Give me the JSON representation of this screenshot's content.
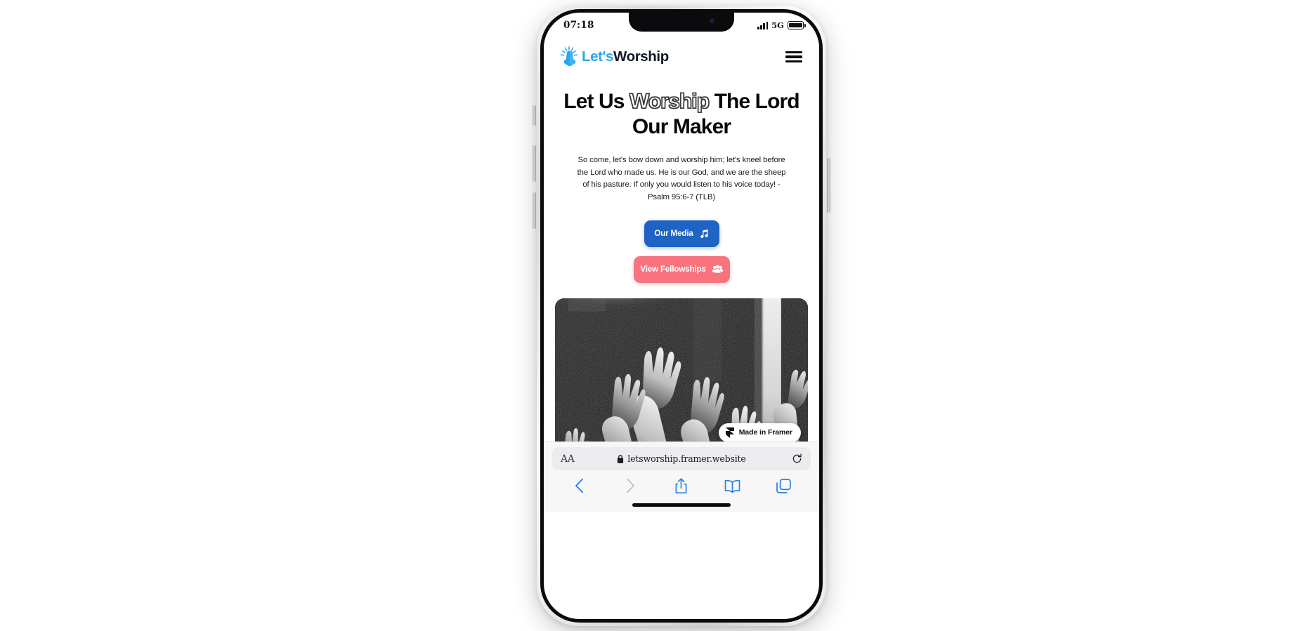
{
  "device": {
    "status_bar": {
      "time": "07:18",
      "network_label": "5G",
      "signal_icon": "signal-bars-icon",
      "battery_icon": "battery-full-icon"
    },
    "home_indicator": "home-indicator"
  },
  "site": {
    "logo": {
      "icon": "praying-hands-icon",
      "text_primary": "Let's",
      "text_secondary": "Worship",
      "color_primary": "#2aa6ef",
      "color_secondary": "#111827"
    },
    "menu_button": "menu-icon"
  },
  "hero": {
    "title_part1": "Let Us ",
    "title_outlined": "Worship",
    "title_part2": " The Lord Our Maker",
    "subtitle": "So come, let's bow down and worship him; let's kneel before the Lord who made us. He is our God, and we are the sheep of his pasture. If only you would listen to his voice today! - Psalm 95:6-7 (TLB)",
    "buttons": [
      {
        "label": "Our Media",
        "icon": "music-note-icon",
        "color": "#1f63c4"
      },
      {
        "label": "View Fellowships",
        "icon": "people-group-icon",
        "color": "#f9737f"
      }
    ],
    "image_alt": "raised-hands-worship-photo"
  },
  "framer_badge": {
    "label": "Made in Framer",
    "icon": "framer-logo-icon"
  },
  "browser": {
    "url_bar": {
      "text_size_label": "AA",
      "lock_icon": "lock-icon",
      "url": "letsworship.framer.website",
      "reload_icon": "reload-icon"
    },
    "toolbar": [
      {
        "name": "back-button",
        "icon": "chevron-left-icon",
        "enabled": true
      },
      {
        "name": "forward-button",
        "icon": "chevron-right-icon",
        "enabled": false
      },
      {
        "name": "share-button",
        "icon": "share-icon",
        "enabled": true
      },
      {
        "name": "bookmarks-button",
        "icon": "book-icon",
        "enabled": true
      },
      {
        "name": "tabs-button",
        "icon": "tabs-icon",
        "enabled": true
      }
    ]
  }
}
